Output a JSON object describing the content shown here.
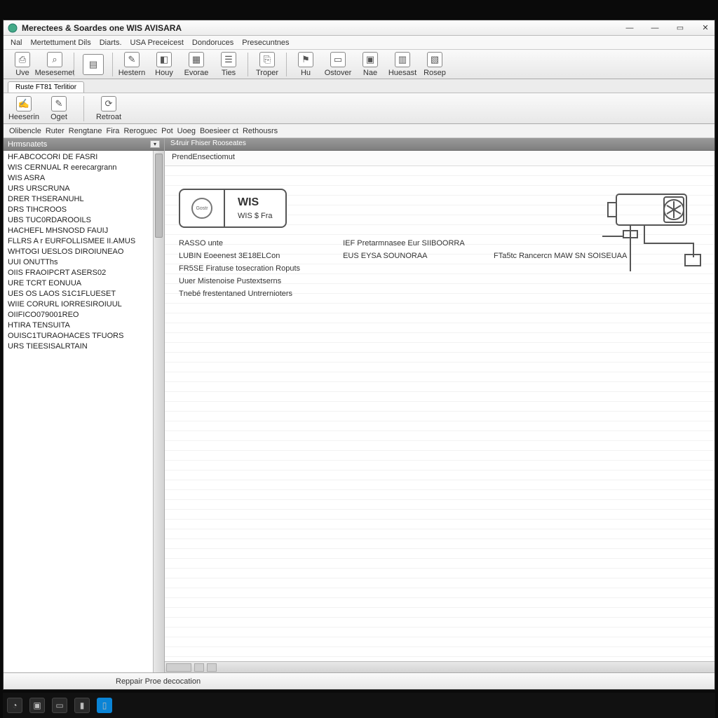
{
  "window": {
    "title": "Merectees & Soardes one WIS AVISARA",
    "menus": [
      "Nal",
      "Mertettument Dils",
      "Diarts.",
      "USA Preceicest",
      "Dondoruces",
      "Presecuntnes"
    ]
  },
  "toolbar_main": [
    {
      "label": "Uve",
      "glyph": "⎙"
    },
    {
      "label": "Mesesemet",
      "glyph": "⌕"
    },
    {
      "sep": true
    },
    {
      "label": "",
      "glyph": "▤",
      "large": true
    },
    {
      "sep": true
    },
    {
      "label": "Hestern",
      "glyph": "✎"
    },
    {
      "label": "Houy",
      "glyph": "◧"
    },
    {
      "label": "Evorae",
      "glyph": "▦"
    },
    {
      "label": "Ties",
      "glyph": "☰"
    },
    {
      "sep": true
    },
    {
      "label": "Troper",
      "glyph": "⎘"
    },
    {
      "sep": true
    },
    {
      "label": "Hu",
      "glyph": "⚑"
    },
    {
      "label": "Ostover",
      "glyph": "▭"
    },
    {
      "label": "Nae",
      "glyph": "▣"
    },
    {
      "label": "Huesast",
      "glyph": "▥"
    },
    {
      "label": "Rosep",
      "glyph": "▧"
    }
  ],
  "page_tab": "Ruste  FT81 Terlitior",
  "toolbar2": [
    {
      "label": "Heeserin",
      "glyph": "✍"
    },
    {
      "label": "Oget",
      "glyph": "✎"
    },
    {
      "sep": true
    },
    {
      "label": "Retroat",
      "glyph": "⟳"
    }
  ],
  "breadcrumb": [
    "Olibencle",
    "Ruter",
    "Rengtane",
    "Fira",
    "Reroguec",
    "Pot",
    "Uoeg",
    "Boesieer ct",
    "Rethousrs"
  ],
  "tree": {
    "header": "Hrmsnatets",
    "items": [
      "HF.ABCOCORI DE FASRI",
      "WIS CERNUAL R eerecargrann",
      "WIS ASRA",
      "URS URSCRUNA",
      "DRER THSERANUHL",
      "DRS TIHCROOS",
      "UBS TUC0RDAROOILS",
      "HACHEFL MHSNOSD FAUIJ",
      "FLLRS A r  EURFOLLISMEE II.AMUS",
      "WHTOGI UESLOS DIROIUNEAO",
      "UUI ONUTThs",
      "OIIS FRAOIPCRT ASERS02",
      "URE TCRT EONUUA",
      "UES OS  LAOS S1C1FLUESET",
      "WIIE CORURL IORRESIROIUUL",
      "OIIFICO079001REO",
      "HTIRA TENSUITA",
      "OUISC1TURAOHACES TFUORS",
      "URS TIEESISALRTAIN"
    ]
  },
  "content": {
    "header": "S4ruir Fhiser Rooseates",
    "sub": "PrendEnsectiomut",
    "card_badge": "Gostr",
    "card_line1": "WIS",
    "card_line2": "WIS $ Fra",
    "col1": [
      "RASSO unte",
      "LUBIN  Eoeenest  3E18ELCon",
      "FR5SE Firatuse tosecration Roputs",
      "Uuer  Mistenoise Pustextserns",
      "Tnebé frestentaned Untrernioters"
    ],
    "col2": [
      "IEF Pretarmnasee    Eur  SIIBOORRA",
      "EUS EYSA SOUNORAA"
    ],
    "col3": [
      "",
      "FTa5tc Rancercn MAW SN  SOISEUAA"
    ]
  },
  "status": "Reppair  Proe  decocation",
  "taskbar_icons": [
    "◔",
    "▣",
    "▭",
    "▮",
    "▯"
  ]
}
